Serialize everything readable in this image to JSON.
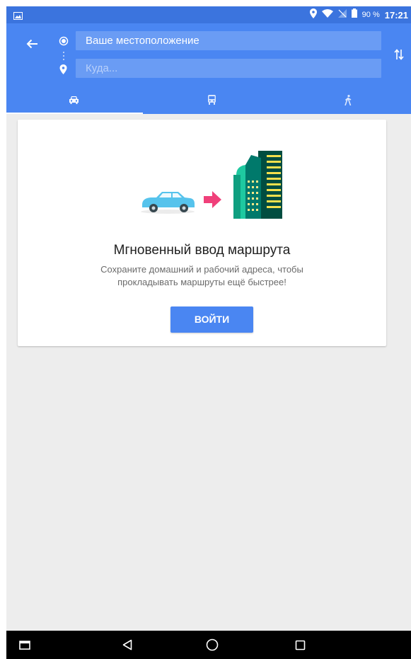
{
  "status_bar": {
    "battery_percent": "90 %",
    "time": "17:21",
    "icons": [
      "image-notification-icon",
      "location-icon",
      "wifi-icon",
      "no-sim-icon",
      "battery-icon"
    ]
  },
  "route": {
    "origin_value": "Ваше местоположение",
    "destination_placeholder": "Куда..."
  },
  "tabs": [
    {
      "name": "drive",
      "icon": "car-icon",
      "selected": true
    },
    {
      "name": "transit",
      "icon": "bus-icon",
      "selected": false
    },
    {
      "name": "walk",
      "icon": "walk-icon",
      "selected": false
    }
  ],
  "card": {
    "title": "Мгновенный ввод маршрута",
    "description_line1": "Сохраните домашний и рабочий адреса, чтобы",
    "description_line2": "прокладывать маршруты ещё быстрее!",
    "button_label": "ВОЙТИ"
  },
  "nav_bar": {
    "icons": [
      "screenshot-icon",
      "back-triangle-icon",
      "home-circle-icon",
      "recents-square-icon"
    ]
  },
  "colors": {
    "app_bar": "#4a86f2",
    "status_bar": "#3b74de",
    "input_bg": "#6a9cf4",
    "background": "#ededed",
    "accent_pink": "#f0407a",
    "car": "#56c3ec",
    "building_green": "#1ec9a0",
    "building_dark": "#00796b"
  }
}
